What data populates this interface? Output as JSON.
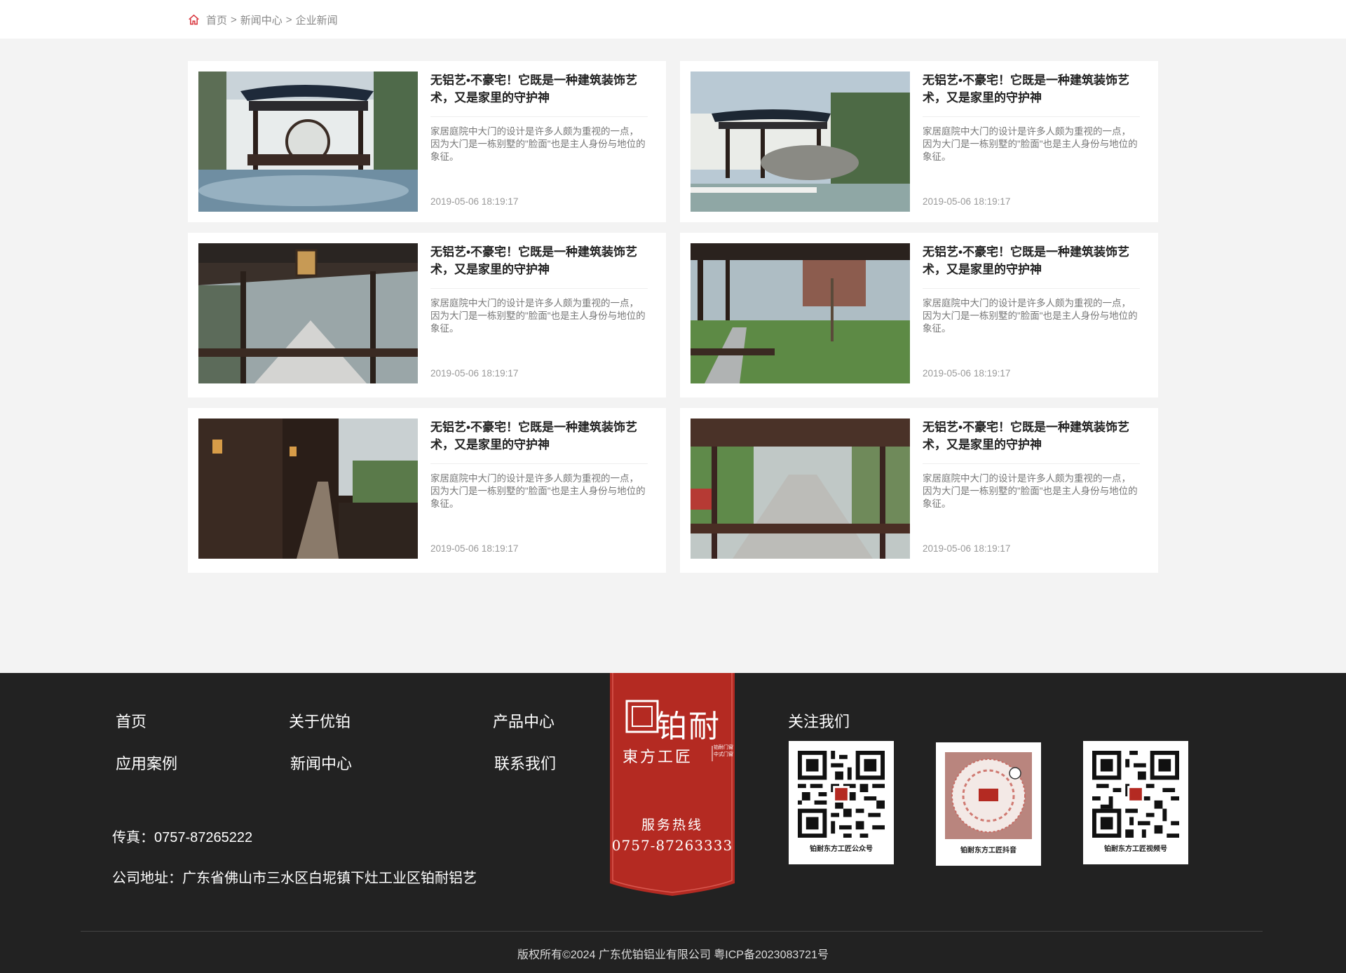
{
  "breadcrumb": {
    "items": [
      "首页",
      "新闻中心",
      "企业新闻"
    ],
    "separator": ">"
  },
  "news": [
    {
      "title": "无铝艺•不豪宅！它既是一种建筑装饰艺术，又是家里的守护神",
      "desc": "家居庭院中大门的设计是许多人颇为重视的一点，因为大门是一栋别墅的\"脸面\"也是主人身份与地位的象征。",
      "date": "2019-05-06 18:19:17"
    },
    {
      "title": "无铝艺•不豪宅！它既是一种建筑装饰艺术，又是家里的守护神",
      "desc": "家居庭院中大门的设计是许多人颇为重视的一点，因为大门是一栋别墅的\"脸面\"也是主人身份与地位的象征。",
      "date": "2019-05-06 18:19:17"
    },
    {
      "title": "无铝艺•不豪宅！它既是一种建筑装饰艺术，又是家里的守护神",
      "desc": "家居庭院中大门的设计是许多人颇为重视的一点，因为大门是一栋别墅的\"脸面\"也是主人身份与地位的象征。",
      "date": "2019-05-06 18:19:17"
    },
    {
      "title": "无铝艺•不豪宅！它既是一种建筑装饰艺术，又是家里的守护神",
      "desc": "家居庭院中大门的设计是许多人颇为重视的一点，因为大门是一栋别墅的\"脸面\"也是主人身份与地位的象征。",
      "date": "2019-05-06 18:19:17"
    },
    {
      "title": "无铝艺•不豪宅！它既是一种建筑装饰艺术，又是家里的守护神",
      "desc": "家居庭院中大门的设计是许多人颇为重视的一点，因为大门是一栋别墅的\"脸面\"也是主人身份与地位的象征。",
      "date": "2019-05-06 18:19:17"
    },
    {
      "title": "无铝艺•不豪宅！它既是一种建筑装饰艺术，又是家里的守护神",
      "desc": "家居庭院中大门的设计是许多人颇为重视的一点，因为大门是一栋别墅的\"脸面\"也是主人身份与地位的象征。",
      "date": "2019-05-06 18:19:17"
    }
  ],
  "footer": {
    "nav": [
      "首页",
      "关于优铂",
      "产品中心",
      "应用案例",
      "新闻中心",
      "联系我们"
    ],
    "fax": "传真：0757-87265222",
    "address": "公司地址：广东省佛山市三水区白坭镇下灶工业区铂耐铝艺",
    "follow_title": "关注我们",
    "qr_codes": [
      "铂耐东方工匠公众号",
      "铂耐东方工匠抖音",
      "铂耐东方工匠视频号"
    ],
    "copyright": "版权所有©2024 广东优铂铝业有限公司    粤ICP备2023083721号"
  },
  "banner": {
    "brand": "铂耐",
    "sub": "東方工匠",
    "tiny": "铂耐门窗 中式门窗",
    "hotline_label": "服务热线",
    "hotline": "0757-87263333"
  },
  "colors": {
    "banner_red": "#b42a22",
    "footer_bg": "#222222",
    "home_icon": "#d9363e"
  }
}
